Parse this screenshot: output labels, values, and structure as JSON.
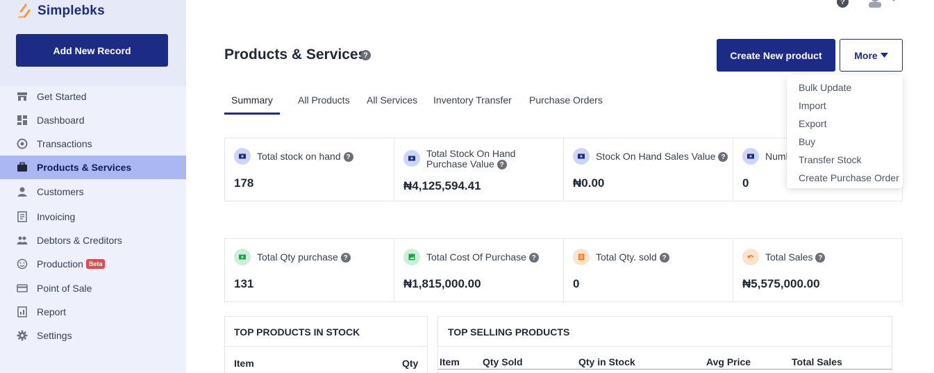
{
  "app": {
    "name": "Simplebks"
  },
  "sidebar": {
    "add_button": "Add New Record",
    "items": [
      {
        "label": "Get Started",
        "icon": "store-icon"
      },
      {
        "label": "Dashboard",
        "icon": "dashboard-icon"
      },
      {
        "label": "Transactions",
        "icon": "transactions-icon"
      },
      {
        "label": "Products & Services",
        "icon": "briefcase-icon",
        "active": true
      },
      {
        "label": "Customers",
        "icon": "user-icon"
      },
      {
        "label": "Invoicing",
        "icon": "invoice-icon"
      },
      {
        "label": "Debtors & Creditors",
        "icon": "people-icon"
      },
      {
        "label": "Production",
        "icon": "production-icon",
        "badge": "Beta"
      },
      {
        "label": "Point of Sale",
        "icon": "card-icon"
      },
      {
        "label": "Report",
        "icon": "report-icon"
      },
      {
        "label": "Settings",
        "icon": "gear-icon"
      }
    ]
  },
  "header": {
    "title": "Products & Services",
    "help": "?",
    "create_button": "Create New product",
    "more_button": "More"
  },
  "tabs": [
    "Summary",
    "All Products",
    "All Services",
    "Inventory Transfer",
    "Purchase Orders"
  ],
  "more_menu": [
    "Bulk Update",
    "Import",
    "Export",
    "Buy",
    "Transfer Stock",
    "Create Purchase Order"
  ],
  "cards_row1": [
    {
      "label": "Total stock on hand",
      "value": "178"
    },
    {
      "label": "Total Stock On Hand Purchase Value",
      "value": "₦4,125,594.41"
    },
    {
      "label": "Stock On Hand Sales Value",
      "value": "₦0.00"
    },
    {
      "label": "Numb",
      "value": "0"
    }
  ],
  "cards_row2": [
    {
      "label": "Total Qty purchase",
      "value": "131"
    },
    {
      "label": "Total Cost Of Purchase",
      "value": "₦1,815,000.00"
    },
    {
      "label": "Total Qty. sold",
      "value": "0"
    },
    {
      "label": "Total Sales",
      "value": "₦5,575,000.00"
    }
  ],
  "top_stock": {
    "title": "TOP PRODUCTS IN STOCK",
    "columns": [
      "Item",
      "Qty"
    ]
  },
  "top_selling": {
    "title": "TOP SELLING PRODUCTS",
    "columns": [
      "Item",
      "Qty Sold",
      "Qty in Stock",
      "Avg Price",
      "Total Sales"
    ]
  },
  "colors": {
    "brand": "#1b2b86",
    "active_nav": "#aab7f0",
    "sidebar_bg": "#eef0fb",
    "beta": "#e5484d"
  }
}
